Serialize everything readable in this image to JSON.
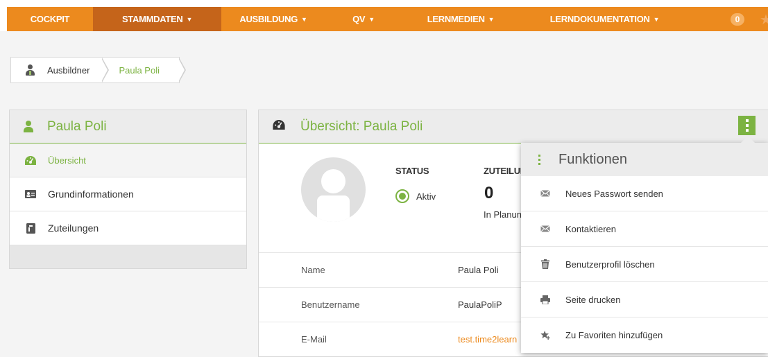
{
  "nav": {
    "items": [
      {
        "label": "COCKPIT",
        "caret": ""
      },
      {
        "label": "STAMMDATEN",
        "caret": "▼"
      },
      {
        "label": "AUSBILDUNG",
        "caret": "▼"
      },
      {
        "label": "QV",
        "caret": "▼"
      },
      {
        "label": "LERNMEDIEN",
        "caret": "▼"
      },
      {
        "label": "LERNDOKUMENTATION",
        "caret": "▼"
      }
    ],
    "badge": "0",
    "accent": "#ec8a1e",
    "active_bg": "#c5641a"
  },
  "breadcrumb": {
    "items": [
      {
        "label": "Ausbildner"
      },
      {
        "label": "Paula Poli"
      }
    ]
  },
  "sidebar": {
    "title": "Paula Poli",
    "items": [
      {
        "label": "Übersicht",
        "icon": "dashboard-icon"
      },
      {
        "label": "Grundinformationen",
        "icon": "id-card-icon"
      },
      {
        "label": "Zuteilungen",
        "icon": "assignment-icon"
      }
    ]
  },
  "main": {
    "title": "Übersicht: Paula Poli",
    "status_label": "STATUS",
    "status_value": "Aktiv",
    "zuteilungen_label": "ZUTEILUNGEN",
    "zuteilungen_count": "0",
    "zuteilungen_sub": "In Planung",
    "rows": [
      {
        "key": "Name",
        "value": "Paula Poli"
      },
      {
        "key": "Benutzername",
        "value": "PaulaPoliP"
      },
      {
        "key": "E-Mail",
        "value": "test.time2learn"
      }
    ]
  },
  "functions": {
    "title": "Funktionen",
    "items": [
      {
        "label": "Neues Passwort senden",
        "icon": "envelope-icon"
      },
      {
        "label": "Kontaktieren",
        "icon": "envelope-icon"
      },
      {
        "label": "Benutzerprofil löschen",
        "icon": "trash-icon"
      },
      {
        "label": "Seite drucken",
        "icon": "print-icon"
      },
      {
        "label": "Zu Favoriten hinzufügen",
        "icon": "star-add-icon"
      }
    ]
  },
  "colors": {
    "green": "#7cb342",
    "link": "#ec8a1e"
  }
}
